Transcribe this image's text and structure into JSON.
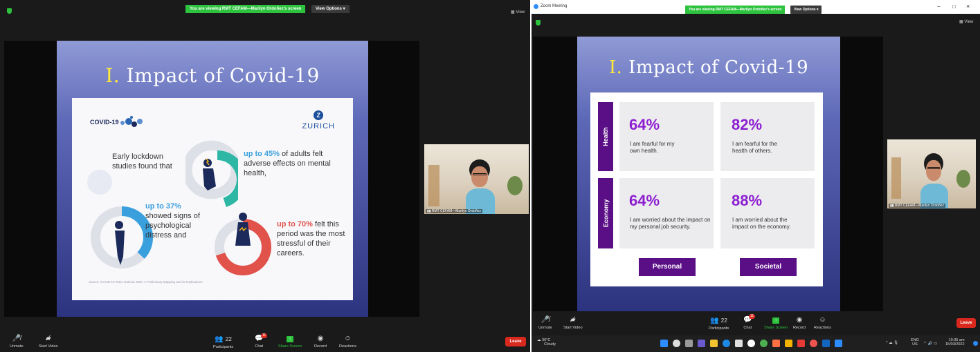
{
  "left": {
    "banner": "You are viewing RMT CEFAM—Marilyn Ordoñez's screen",
    "view_options": "View Options ▾",
    "view": "View",
    "slide": {
      "title_roman": "I.",
      "title_text": " Impact of Covid-19",
      "covid_label": "COVID-19",
      "brand": "ZURICH",
      "intro": "Early lockdown studies found that",
      "stat45_strong": "up to 45%",
      "stat45_rest": " of adults felt adverse effects on mental health,",
      "stat37_strong": "up to 37%",
      "stat37_rest": "showed signs of psychological distress and",
      "stat70_strong": "up to 70%",
      "stat70_rest": " felt this period was the most stressful of their careers.",
      "source": "Source: COVID-19 Risks Outlook 2020: A Preliminary Mapping and its Implications",
      "donut_values": {
        "adults_adverse_pct": 45,
        "psych_distress_pct": 37,
        "most_stressful_pct": 70
      }
    },
    "participant": "RMT CEFAM—Marilyn Ordoñez",
    "toolbar": {
      "unmute": "Unmute",
      "start_video": "Start Video",
      "participants": "Participants",
      "participants_count": "22",
      "chat": "Chat",
      "chat_badge": "11",
      "share": "Share Screen",
      "record": "Record",
      "reactions": "Reactions",
      "leave": "Leave"
    }
  },
  "right": {
    "window_title": "Zoom Meeting",
    "banner": "You are viewing RMT CEFAM—Marilyn Ordoñez's screen",
    "view_options": "View Options ▾",
    "view": "View",
    "window_controls": [
      "−",
      "□",
      "×"
    ],
    "slide": {
      "title_roman": "I.",
      "title_text": " Impact of Covid-19",
      "row_labels": [
        "Health",
        "Economy"
      ],
      "stats": [
        {
          "pct": "64%",
          "desc": "I am fearful for my own health."
        },
        {
          "pct": "82%",
          "desc": "I am fearful for the health of others."
        },
        {
          "pct": "64%",
          "desc": "I am worried about the impact on my personal job security."
        },
        {
          "pct": "88%",
          "desc": "I am worried about the impact on the economy."
        }
      ],
      "col_labels": [
        "Personal",
        "Societal"
      ]
    },
    "participant": "RMT CEFAM—Marilyn Ordoñez",
    "toolbar": {
      "unmute": "Unmute",
      "start_video": "Start Video",
      "participants": "Participants",
      "participants_count": "22",
      "chat": "Chat",
      "chat_badge": "11",
      "share": "Share Screen",
      "record": "Record",
      "reactions": "Reactions",
      "leave": "Leave"
    },
    "taskbar": {
      "weather_temp": "30°C",
      "weather_desc": "Cloudy",
      "lang": "ENG",
      "region": "US",
      "time": "10:35 am",
      "date": "15/03/2022"
    }
  },
  "colors": {
    "accent_green": "#2ec33f",
    "leave_red": "#d9281e",
    "stat_purple": "#8d1fd1",
    "label_purple": "#5a0f86"
  }
}
